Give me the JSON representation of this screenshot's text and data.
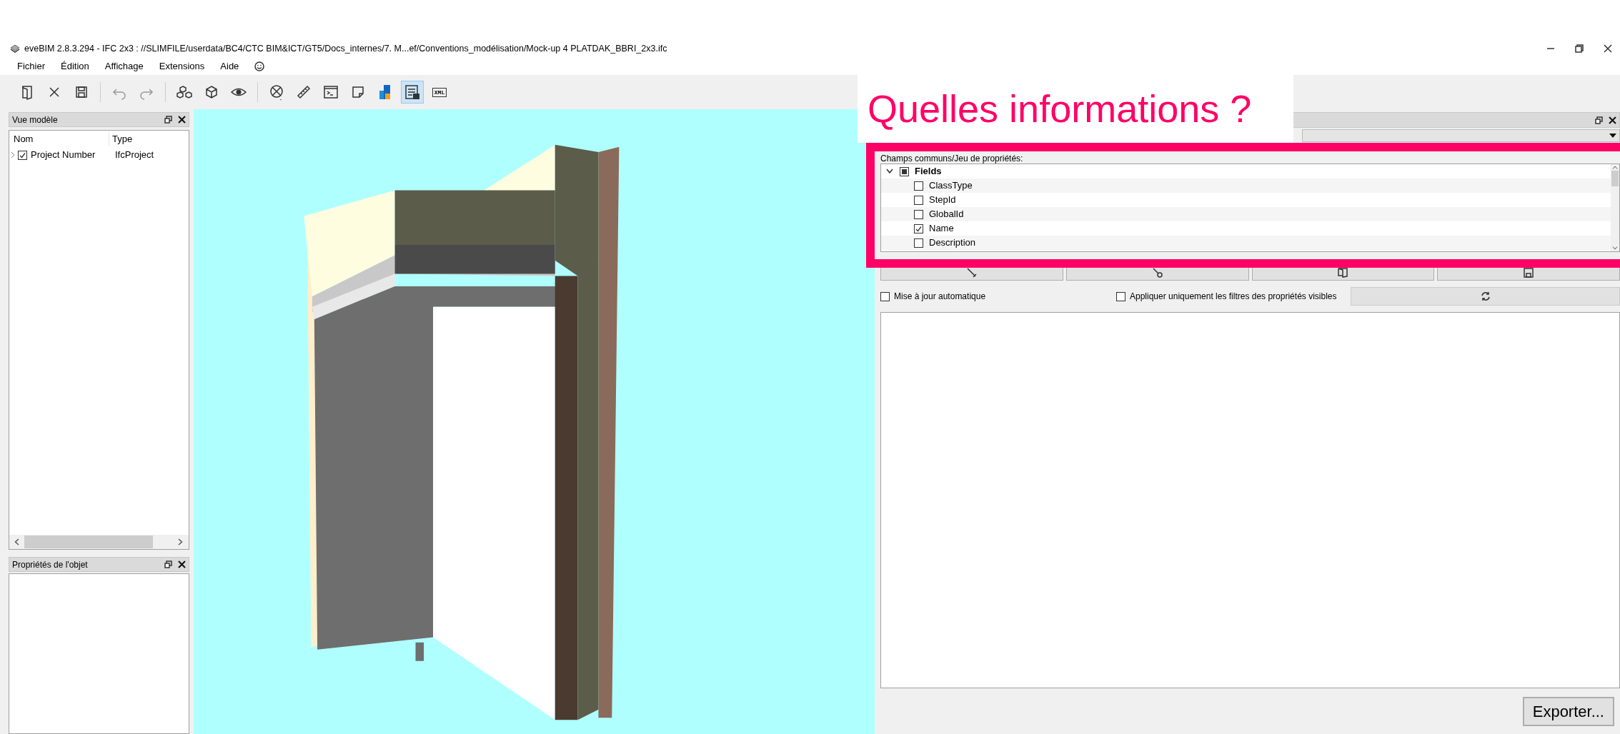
{
  "window": {
    "title": "eveBIM 2.8.3.294 - IFC 2x3 : //SLIMFILE/userdata/BC4/CTC BIM&ICT/GT5/Docs_internes/7. M...ef/Conventions_modélisation/Mock-up 4 PLATDAK_BBRI_2x3.ifc"
  },
  "menu": [
    "Fichier",
    "Édition",
    "Affichage",
    "Extensions",
    "Aide"
  ],
  "toolbar": [
    {
      "selected": false
    },
    {
      "selected": false
    },
    {
      "selected": false
    },
    {
      "selected": false
    },
    {
      "selected": false
    },
    {
      "selected": false
    },
    {
      "selected": false
    },
    {
      "selected": false
    },
    {
      "selected": false
    },
    {
      "selected": false
    },
    {
      "selected": false
    },
    {
      "selected": false
    },
    {
      "selected": false
    },
    {
      "selected": true
    },
    {
      "selected": false,
      "label": "XML"
    }
  ],
  "model_view": {
    "title": "Vue modèle",
    "columns": [
      "Nom",
      "Type"
    ],
    "rows": [
      {
        "name": "Project Number",
        "type": "IfcProject",
        "checked": true,
        "expanded": false
      }
    ]
  },
  "object_properties": {
    "title": "Propriétés de l'objet"
  },
  "annotation": {
    "title": "Quelles informations ?"
  },
  "property_panel": {
    "label": "Champs communs/Jeu de propriétés:",
    "tree": [
      {
        "label": "Fields",
        "checked": false,
        "indeterminate": true,
        "expanded": true,
        "children": [
          {
            "label": "ClassType",
            "checked": false,
            "indeterminate": false
          },
          {
            "label": "StepId",
            "checked": false,
            "indeterminate": false
          },
          {
            "label": "GlobalId",
            "checked": false,
            "indeterminate": false
          },
          {
            "label": "Name",
            "checked": true,
            "indeterminate": false
          },
          {
            "label": "Description",
            "checked": false,
            "indeterminate": false
          }
        ]
      }
    ],
    "options": [
      {
        "label": "Mise à jour automatique",
        "checked": false
      },
      {
        "label": "Appliquer uniquement les filtres des propriétés visibles",
        "checked": false
      }
    ],
    "export_button": "Exporter..."
  }
}
